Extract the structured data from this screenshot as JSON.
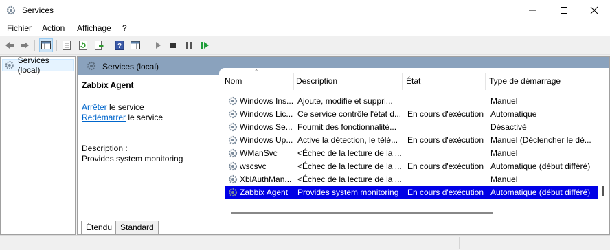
{
  "window": {
    "title": "Services"
  },
  "menu": [
    "Fichier",
    "Action",
    "Affichage",
    "?"
  ],
  "tree": {
    "root_label": "Services (local)"
  },
  "panel": {
    "header_title": "Services (local)",
    "selected_service": "Zabbix Agent",
    "actions": [
      {
        "link": "Arrêter",
        "rest": " le service"
      },
      {
        "link": "Redémarrer",
        "rest": " le service"
      }
    ],
    "description_label": "Description :",
    "description_text": "Provides system monitoring"
  },
  "list": {
    "columns": [
      "Nom",
      "Description",
      "État",
      "Type de démarrage"
    ],
    "rows": [
      {
        "name": "Windows Ins...",
        "description": "Ajoute, modifie et suppri...",
        "state": "",
        "startup": "Manuel"
      },
      {
        "name": "Windows Lic...",
        "description": "Ce service contrôle l'état d...",
        "state": "En cours d'exécution",
        "startup": "Automatique"
      },
      {
        "name": "Windows Se...",
        "description": "Fournit des fonctionnalité...",
        "state": "",
        "startup": "Désactivé"
      },
      {
        "name": "Windows Up...",
        "description": "Active la détection, le télé...",
        "state": "En cours d'exécution",
        "startup": "Manuel (Déclencher le dé..."
      },
      {
        "name": "WManSvc",
        "description": "<Échec de la lecture de la ...",
        "state": "",
        "startup": "Manuel"
      },
      {
        "name": "wscsvc",
        "description": "<Échec de la lecture de la ...",
        "state": "En cours d'exécution",
        "startup": "Automatique (début différé)"
      },
      {
        "name": "XblAuthMan...",
        "description": "<Échec de la lecture de la ...",
        "state": "",
        "startup": "Manuel"
      },
      {
        "name": "Zabbix Agent",
        "description": "Provides system monitoring",
        "state": "En cours d'exécution",
        "startup": "Automatique (début différé)"
      }
    ],
    "selected_index": 7
  },
  "tabs": [
    "Étendu",
    "Standard"
  ],
  "colors": {
    "header_bar": "#8aa2bd",
    "selection": "#0000e6",
    "link": "#0066cc"
  }
}
